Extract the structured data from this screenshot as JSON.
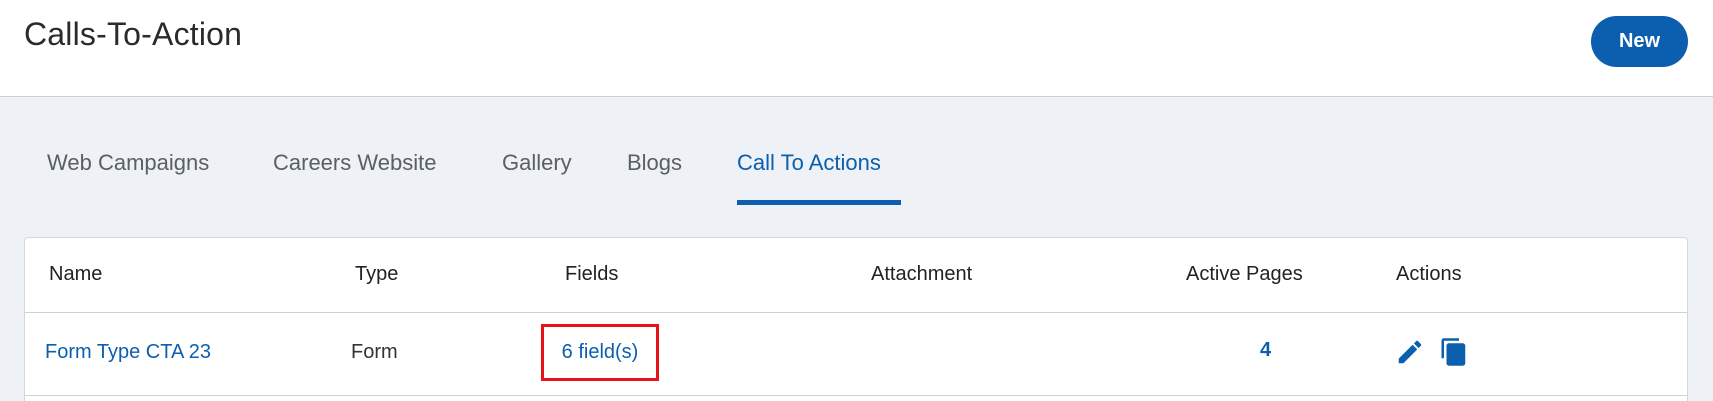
{
  "header": {
    "title": "Calls-To-Action",
    "new_button_label": "New"
  },
  "tabs": [
    {
      "label": "Web Campaigns",
      "active": false
    },
    {
      "label": "Careers Website",
      "active": false
    },
    {
      "label": "Gallery",
      "active": false
    },
    {
      "label": "Blogs",
      "active": false
    },
    {
      "label": "Call To Actions",
      "active": true
    }
  ],
  "table": {
    "columns": [
      "Name",
      "Type",
      "Fields",
      "Attachment",
      "Active Pages",
      "Actions"
    ],
    "rows": [
      {
        "name": "Form Type CTA 23",
        "type": "Form",
        "fields": "6 field(s)",
        "attachment": "",
        "active_pages": "4",
        "actions": [
          "edit-icon",
          "copy-icon"
        ]
      }
    ]
  },
  "colors": {
    "accent": "#0b5fae",
    "highlight_border": "#e3141b",
    "background": "#eef2f6"
  }
}
